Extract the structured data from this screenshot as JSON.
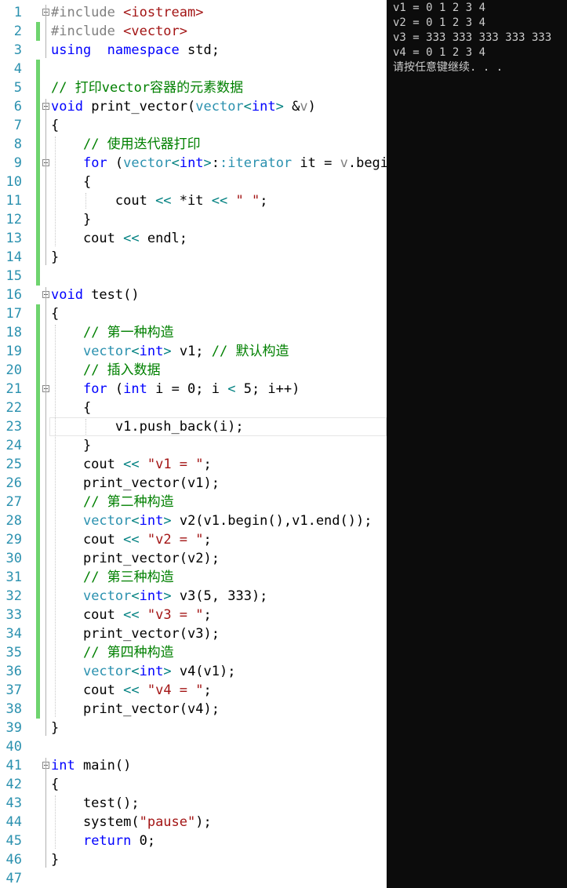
{
  "editor": {
    "lines": [
      {
        "n": "1",
        "t": [
          [
            "pp",
            "#include "
          ],
          [
            "str",
            "<iostream>"
          ]
        ]
      },
      {
        "n": "2",
        "t": [
          [
            "pp",
            "#include "
          ],
          [
            "str",
            "<vector>"
          ]
        ]
      },
      {
        "n": "3",
        "t": [
          [
            "kw",
            "using"
          ],
          [
            "",
            "  "
          ],
          [
            "kw",
            "namespace"
          ],
          [
            "",
            " std;"
          ]
        ]
      },
      {
        "n": "4",
        "t": []
      },
      {
        "n": "5",
        "t": [
          [
            "cm",
            "// 打印vector容器的元素数据"
          ]
        ]
      },
      {
        "n": "6",
        "t": [
          [
            "kw",
            "void"
          ],
          [
            "",
            " print_vector("
          ],
          [
            "ty",
            "vector"
          ],
          [
            "op",
            "<"
          ],
          [
            "kw",
            "int"
          ],
          [
            "op",
            ">"
          ],
          [
            "",
            " &"
          ],
          [
            "pm",
            "v"
          ],
          [
            "",
            ")"
          ]
        ]
      },
      {
        "n": "7",
        "t": [
          [
            "",
            "{"
          ]
        ]
      },
      {
        "n": "8",
        "t": [
          [
            "",
            "    "
          ],
          [
            "cm",
            "// 使用迭代器打印"
          ]
        ]
      },
      {
        "n": "9",
        "t": [
          [
            "",
            "    "
          ],
          [
            "kw",
            "for"
          ],
          [
            "",
            " ("
          ],
          [
            "ty",
            "vector"
          ],
          [
            "op",
            "<"
          ],
          [
            "kw",
            "int"
          ],
          [
            "op",
            ">"
          ],
          [
            "",
            ":"
          ],
          [
            "ty",
            ":iterator"
          ],
          [
            "",
            " it = "
          ],
          [
            "pm",
            "v"
          ],
          [
            "",
            ".begin"
          ]
        ]
      },
      {
        "n": "10",
        "t": [
          [
            "",
            "    {"
          ]
        ]
      },
      {
        "n": "11",
        "t": [
          [
            "",
            "        cout "
          ],
          [
            "op",
            "<<"
          ],
          [
            "",
            " *it "
          ],
          [
            "op",
            "<<"
          ],
          [
            "",
            " "
          ],
          [
            "str",
            "\" \""
          ],
          [
            "",
            ";"
          ]
        ]
      },
      {
        "n": "12",
        "t": [
          [
            "",
            "    }"
          ]
        ]
      },
      {
        "n": "13",
        "t": [
          [
            "",
            "    cout "
          ],
          [
            "op",
            "<<"
          ],
          [
            "",
            " endl;"
          ]
        ]
      },
      {
        "n": "14",
        "t": [
          [
            "",
            "}"
          ]
        ]
      },
      {
        "n": "15",
        "t": []
      },
      {
        "n": "16",
        "t": [
          [
            "kw",
            "void"
          ],
          [
            "",
            " test()"
          ]
        ]
      },
      {
        "n": "17",
        "t": [
          [
            "",
            "{"
          ]
        ]
      },
      {
        "n": "18",
        "t": [
          [
            "",
            "    "
          ],
          [
            "cm",
            "// 第一种构造"
          ]
        ]
      },
      {
        "n": "19",
        "t": [
          [
            "",
            "    "
          ],
          [
            "ty",
            "vector"
          ],
          [
            "op",
            "<"
          ],
          [
            "kw",
            "int"
          ],
          [
            "op",
            ">"
          ],
          [
            "",
            " v1; "
          ],
          [
            "cm",
            "// 默认构造"
          ]
        ]
      },
      {
        "n": "20",
        "t": [
          [
            "",
            "    "
          ],
          [
            "cm",
            "// 插入数据"
          ]
        ]
      },
      {
        "n": "21",
        "t": [
          [
            "",
            "    "
          ],
          [
            "kw",
            "for"
          ],
          [
            "",
            " ("
          ],
          [
            "kw",
            "int"
          ],
          [
            "",
            " i = 0; i "
          ],
          [
            "op",
            "<"
          ],
          [
            "",
            " 5; i++)"
          ]
        ]
      },
      {
        "n": "22",
        "t": [
          [
            "",
            "    {"
          ]
        ]
      },
      {
        "n": "23",
        "t": [
          [
            "",
            "        v1.push_back(i);"
          ]
        ]
      },
      {
        "n": "24",
        "t": [
          [
            "",
            "    }"
          ]
        ]
      },
      {
        "n": "25",
        "t": [
          [
            "",
            "    cout "
          ],
          [
            "op",
            "<<"
          ],
          [
            "",
            " "
          ],
          [
            "str",
            "\"v1 = \""
          ],
          [
            "",
            ";"
          ]
        ]
      },
      {
        "n": "26",
        "t": [
          [
            "",
            "    print_vector(v1);"
          ]
        ]
      },
      {
        "n": "27",
        "t": [
          [
            "",
            "    "
          ],
          [
            "cm",
            "// 第二种构造"
          ]
        ]
      },
      {
        "n": "28",
        "t": [
          [
            "",
            "    "
          ],
          [
            "ty",
            "vector"
          ],
          [
            "op",
            "<"
          ],
          [
            "kw",
            "int"
          ],
          [
            "op",
            ">"
          ],
          [
            "",
            " v2(v1.begin(),v1.end());"
          ]
        ]
      },
      {
        "n": "29",
        "t": [
          [
            "",
            "    cout "
          ],
          [
            "op",
            "<<"
          ],
          [
            "",
            " "
          ],
          [
            "str",
            "\"v2 = \""
          ],
          [
            "",
            ";"
          ]
        ]
      },
      {
        "n": "30",
        "t": [
          [
            "",
            "    print_vector(v2);"
          ]
        ]
      },
      {
        "n": "31",
        "t": [
          [
            "",
            "    "
          ],
          [
            "cm",
            "// 第三种构造"
          ]
        ]
      },
      {
        "n": "32",
        "t": [
          [
            "",
            "    "
          ],
          [
            "ty",
            "vector"
          ],
          [
            "op",
            "<"
          ],
          [
            "kw",
            "int"
          ],
          [
            "op",
            ">"
          ],
          [
            "",
            " v3(5, 333);"
          ]
        ]
      },
      {
        "n": "33",
        "t": [
          [
            "",
            "    cout "
          ],
          [
            "op",
            "<<"
          ],
          [
            "",
            " "
          ],
          [
            "str",
            "\"v3 = \""
          ],
          [
            "",
            ";"
          ]
        ]
      },
      {
        "n": "34",
        "t": [
          [
            "",
            "    print_vector(v3);"
          ]
        ]
      },
      {
        "n": "35",
        "t": [
          [
            "",
            "    "
          ],
          [
            "cm",
            "// 第四种构造"
          ]
        ]
      },
      {
        "n": "36",
        "t": [
          [
            "",
            "    "
          ],
          [
            "ty",
            "vector"
          ],
          [
            "op",
            "<"
          ],
          [
            "kw",
            "int"
          ],
          [
            "op",
            ">"
          ],
          [
            "",
            " v4(v1);"
          ]
        ]
      },
      {
        "n": "37",
        "t": [
          [
            "",
            "    cout "
          ],
          [
            "op",
            "<<"
          ],
          [
            "",
            " "
          ],
          [
            "str",
            "\"v4 = \""
          ],
          [
            "",
            ";"
          ]
        ]
      },
      {
        "n": "38",
        "t": [
          [
            "",
            "    print_vector(v4);"
          ]
        ]
      },
      {
        "n": "39",
        "t": [
          [
            "",
            "}"
          ]
        ]
      },
      {
        "n": "40",
        "t": []
      },
      {
        "n": "41",
        "t": [
          [
            "kw",
            "int"
          ],
          [
            "",
            " main()"
          ]
        ]
      },
      {
        "n": "42",
        "t": [
          [
            "",
            "{"
          ]
        ]
      },
      {
        "n": "43",
        "t": [
          [
            "",
            "    test();"
          ]
        ]
      },
      {
        "n": "44",
        "t": [
          [
            "",
            "    system("
          ],
          [
            "str",
            "\"pause\""
          ],
          [
            "",
            ");"
          ]
        ]
      },
      {
        "n": "45",
        "t": [
          [
            "",
            "    "
          ],
          [
            "kw",
            "return"
          ],
          [
            "",
            " 0;"
          ]
        ]
      },
      {
        "n": "46",
        "t": [
          [
            "",
            "}"
          ]
        ]
      },
      {
        "n": "47",
        "t": []
      }
    ],
    "changed_lines": [
      "2",
      "4",
      "5",
      "6",
      "7",
      "8",
      "9",
      "10",
      "11",
      "12",
      "13",
      "14",
      "15",
      "17",
      "18",
      "19",
      "20",
      "21",
      "22",
      "23",
      "24",
      "25",
      "26",
      "27",
      "28",
      "29",
      "30",
      "31",
      "32",
      "33",
      "34",
      "35",
      "36",
      "37",
      "38"
    ],
    "fold_lines": [
      "1",
      "6",
      "9",
      "16",
      "21",
      "41"
    ],
    "current_line": "23"
  },
  "console": {
    "lines": [
      "v1 = 0 1 2 3 4",
      "v2 = 0 1 2 3 4",
      "v3 = 333 333 333 333 333",
      "v4 = 0 1 2 3 4",
      "请按任意键继续. . ."
    ]
  },
  "colors": {
    "keyword": "#0000ff",
    "type": "#2b91af",
    "string": "#a31515",
    "comment": "#008000",
    "operator": "#008080",
    "preprocessor": "#808080",
    "change_bar": "#6fd46f",
    "console_bg": "#0c0c0c",
    "console_text": "#cccccc"
  }
}
